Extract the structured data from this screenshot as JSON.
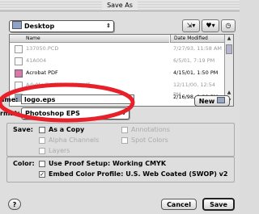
{
  "window": {
    "title": "Save As"
  },
  "location": {
    "selected": "Desktop"
  },
  "file_list": {
    "columns": [
      "Name",
      "Date Modified"
    ],
    "rows": [
      {
        "name": "137050.PCD",
        "date": "7/27/93, 11:58 AM",
        "enabled": false
      },
      {
        "name": "41A004",
        "date": "6/5/01, 7:19 PM",
        "enabled": false
      },
      {
        "name": "Acrobat PDF",
        "date": "4/15/01, 1:50 PM",
        "enabled": true
      },
      {
        "name": "AdvMedicalDirective.pdf",
        "date": "12/11/00, 12:54 PM",
        "enabled": false
      },
      {
        "name": "Ad",
        "date": "2/16/98, 2:29 PM",
        "enabled": true
      }
    ]
  },
  "name": {
    "label": "ame:",
    "value": "logo.eps"
  },
  "new_button": "New",
  "format": {
    "label": "rmat:",
    "selected": "Photoshop EPS"
  },
  "save_options": {
    "label": "Save:",
    "as_a_copy": "As a Copy",
    "alpha_channels": "Alpha Channels",
    "layers": "Layers",
    "annotations": "Annotations",
    "spot_colors": "Spot Colors"
  },
  "color": {
    "label": "Color:",
    "use_proof_setup": "Use Proof Setup: Working CMYK",
    "embed_profile": "Embed Color Profile: U.S. Web Coated (SWOP) v2",
    "embed_checked": true
  },
  "buttons": {
    "cancel": "Cancel",
    "save": "Save",
    "help": "?"
  },
  "highlight_color": "#e8202a"
}
